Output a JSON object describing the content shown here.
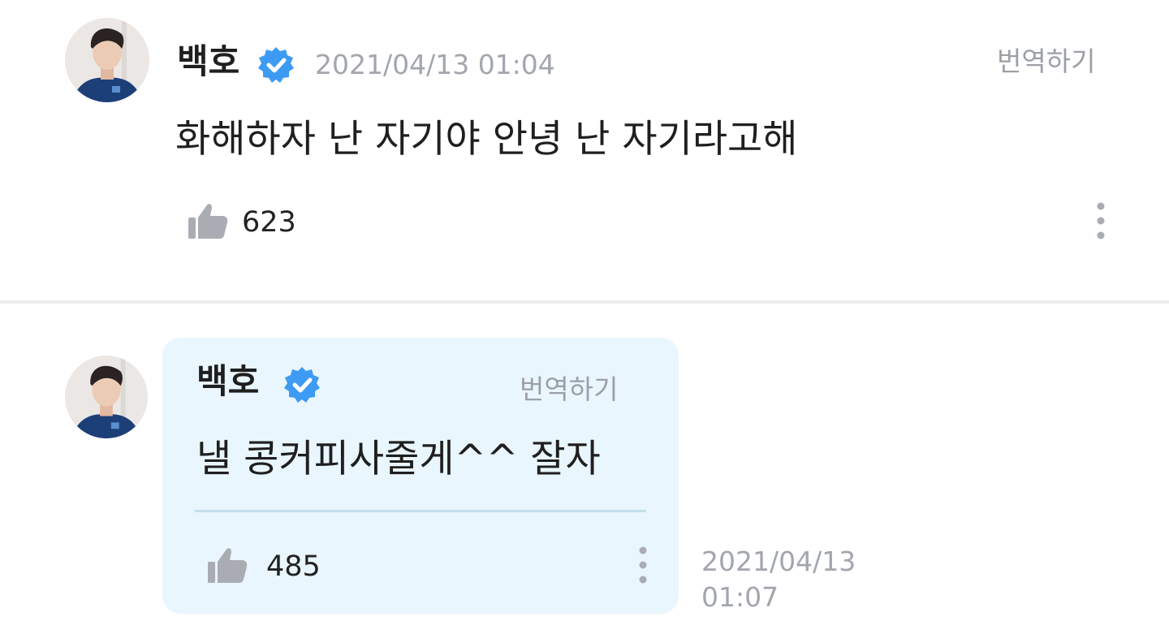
{
  "colors": {
    "verified_badge": "#3d9bf3",
    "reply_bubble": "#e9f6fd",
    "muted_text": "#a2a6ad",
    "icon_gray": "#a9adb3"
  },
  "comment": {
    "avatar_icon": "profile-photo-avatar",
    "author": "백호",
    "verified_icon": "verified-check-badge-icon",
    "timestamp": "2021/04/13 01:04",
    "translate_label": "번역하기",
    "message": "화해하자 난 자기야 안녕 난 자기라고해",
    "like_icon": "thumbs-up-icon",
    "like_count": "623",
    "more_icon": "vertical-dots-icon"
  },
  "reply": {
    "avatar_icon": "profile-photo-avatar",
    "author": "백호",
    "verified_icon": "verified-check-badge-icon",
    "translate_label": "번역하기",
    "message": "낼 콩커피사줄게^^ 잘자",
    "like_icon": "thumbs-up-icon",
    "like_count": "485",
    "more_icon": "vertical-dots-icon",
    "timestamp_date": "2021/04/13",
    "timestamp_time": "01:07"
  }
}
